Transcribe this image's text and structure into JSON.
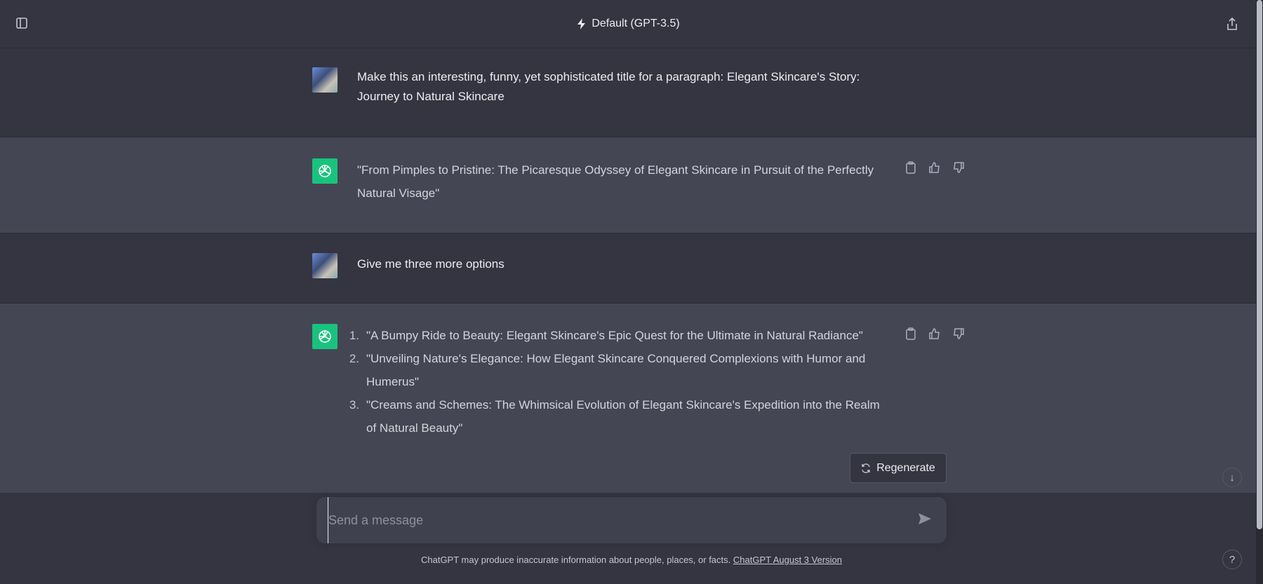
{
  "header": {
    "title": "Default (GPT-3.5)"
  },
  "conversation": [
    {
      "role": "user",
      "text": "Make this an interesting, funny, yet sophisticated title for a paragraph: Elegant Skincare's Story: Journey to Natural Skincare"
    },
    {
      "role": "assistant",
      "text": "\"From Pimples to Pristine: The Picaresque Odyssey of Elegant Skincare in Pursuit of the Perfectly Natural Visage\""
    },
    {
      "role": "user",
      "text": "Give me three more options"
    },
    {
      "role": "assistant",
      "items": [
        {
          "num": "1.",
          "text": "\"A Bumpy Ride to Beauty: Elegant Skincare's Epic Quest for the Ultimate in Natural Radiance\""
        },
        {
          "num": "2.",
          "text": "\"Unveiling Nature's Elegance: How Elegant Skincare Conquered Complexions with Humor and Humerus\""
        },
        {
          "num": "3.",
          "text": "\"Creams and Schemes: The Whimsical Evolution of Elegant Skincare's Expedition into the Realm of Natural Beauty\""
        }
      ]
    }
  ],
  "regenerate_label": "Regenerate",
  "input": {
    "placeholder": "Send a message",
    "value": ""
  },
  "footer": {
    "text": "ChatGPT may produce inaccurate information about people, places, or facts. ",
    "link": "ChatGPT August 3 Version"
  },
  "help_label": "?"
}
